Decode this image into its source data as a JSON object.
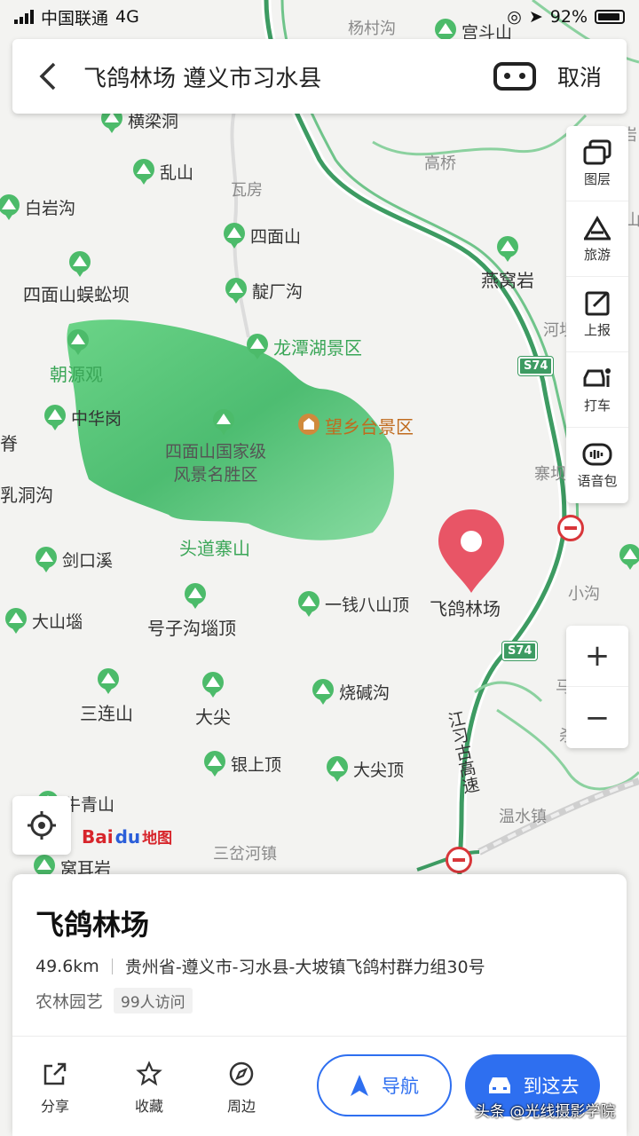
{
  "status_bar": {
    "carrier": "中国联通",
    "network": "4G",
    "battery": "92%",
    "battery_level": 0.92
  },
  "search": {
    "query": "飞鸽林场 遵义市习水县",
    "cancel_label": "取消"
  },
  "toolbar": {
    "items": [
      {
        "label": "图层",
        "icon": "layers-icon"
      },
      {
        "label": "旅游",
        "icon": "travel-icon"
      },
      {
        "label": "上报",
        "icon": "report-icon"
      },
      {
        "label": "打车",
        "icon": "taxi-icon"
      },
      {
        "label": "语音包",
        "icon": "voice-pack-icon"
      }
    ]
  },
  "zoom": {
    "in": "+",
    "out": "−"
  },
  "logo": {
    "b1": "Bai",
    "b2": "du",
    "b3": "地图"
  },
  "map": {
    "pois": [
      "横梁洞",
      "乱山",
      "白岩沟",
      "四面山",
      "四面山蜈蚣坝",
      "靛厂沟",
      "中华岗",
      "剑口溪",
      "大山堖",
      "号子沟堖顶",
      "一钱八山顶",
      "三连山",
      "大尖",
      "烧碱沟",
      "银上顶",
      "大尖顶",
      "牛青山",
      "燕窝岩",
      "杨村沟",
      "宫斗山",
      "窝耳岩"
    ],
    "places": [
      "瓦房",
      "高桥",
      "河坝",
      "寨坝",
      "小沟",
      "温水镇",
      "三岔河镇",
      "马",
      "杀",
      "岩",
      "山",
      "脊",
      "乳洞沟",
      "岗"
    ],
    "green_labels": [
      "龙潭湖景区",
      "朝源观",
      "头道寨山"
    ],
    "scenic_area": [
      "四面山国家级",
      "风景名胜区"
    ],
    "attraction": "望乡台景区",
    "highway_shield": "S74",
    "expressway": "江习古高速",
    "destination": "飞鸽林场"
  },
  "card": {
    "name": "飞鸽林场",
    "distance": "49.6km",
    "address": "贵州省-遵义市-习水县-大坡镇飞鸽村群力组30号",
    "category": "农林园艺",
    "visits": "99人访问"
  },
  "actions": [
    {
      "label": "分享",
      "icon": "share-icon"
    },
    {
      "label": "收藏",
      "icon": "star-icon"
    },
    {
      "label": "周边",
      "icon": "compass-icon"
    }
  ],
  "buttons": {
    "navigate": "导航",
    "go_here": "到这去"
  },
  "watermark": "头条 @光线摄影学院",
  "colors": {
    "accent": "#2e6ff0",
    "road_green": "#3d9b62",
    "park_green": "#4cc26a",
    "pin_red": "#e85566"
  }
}
